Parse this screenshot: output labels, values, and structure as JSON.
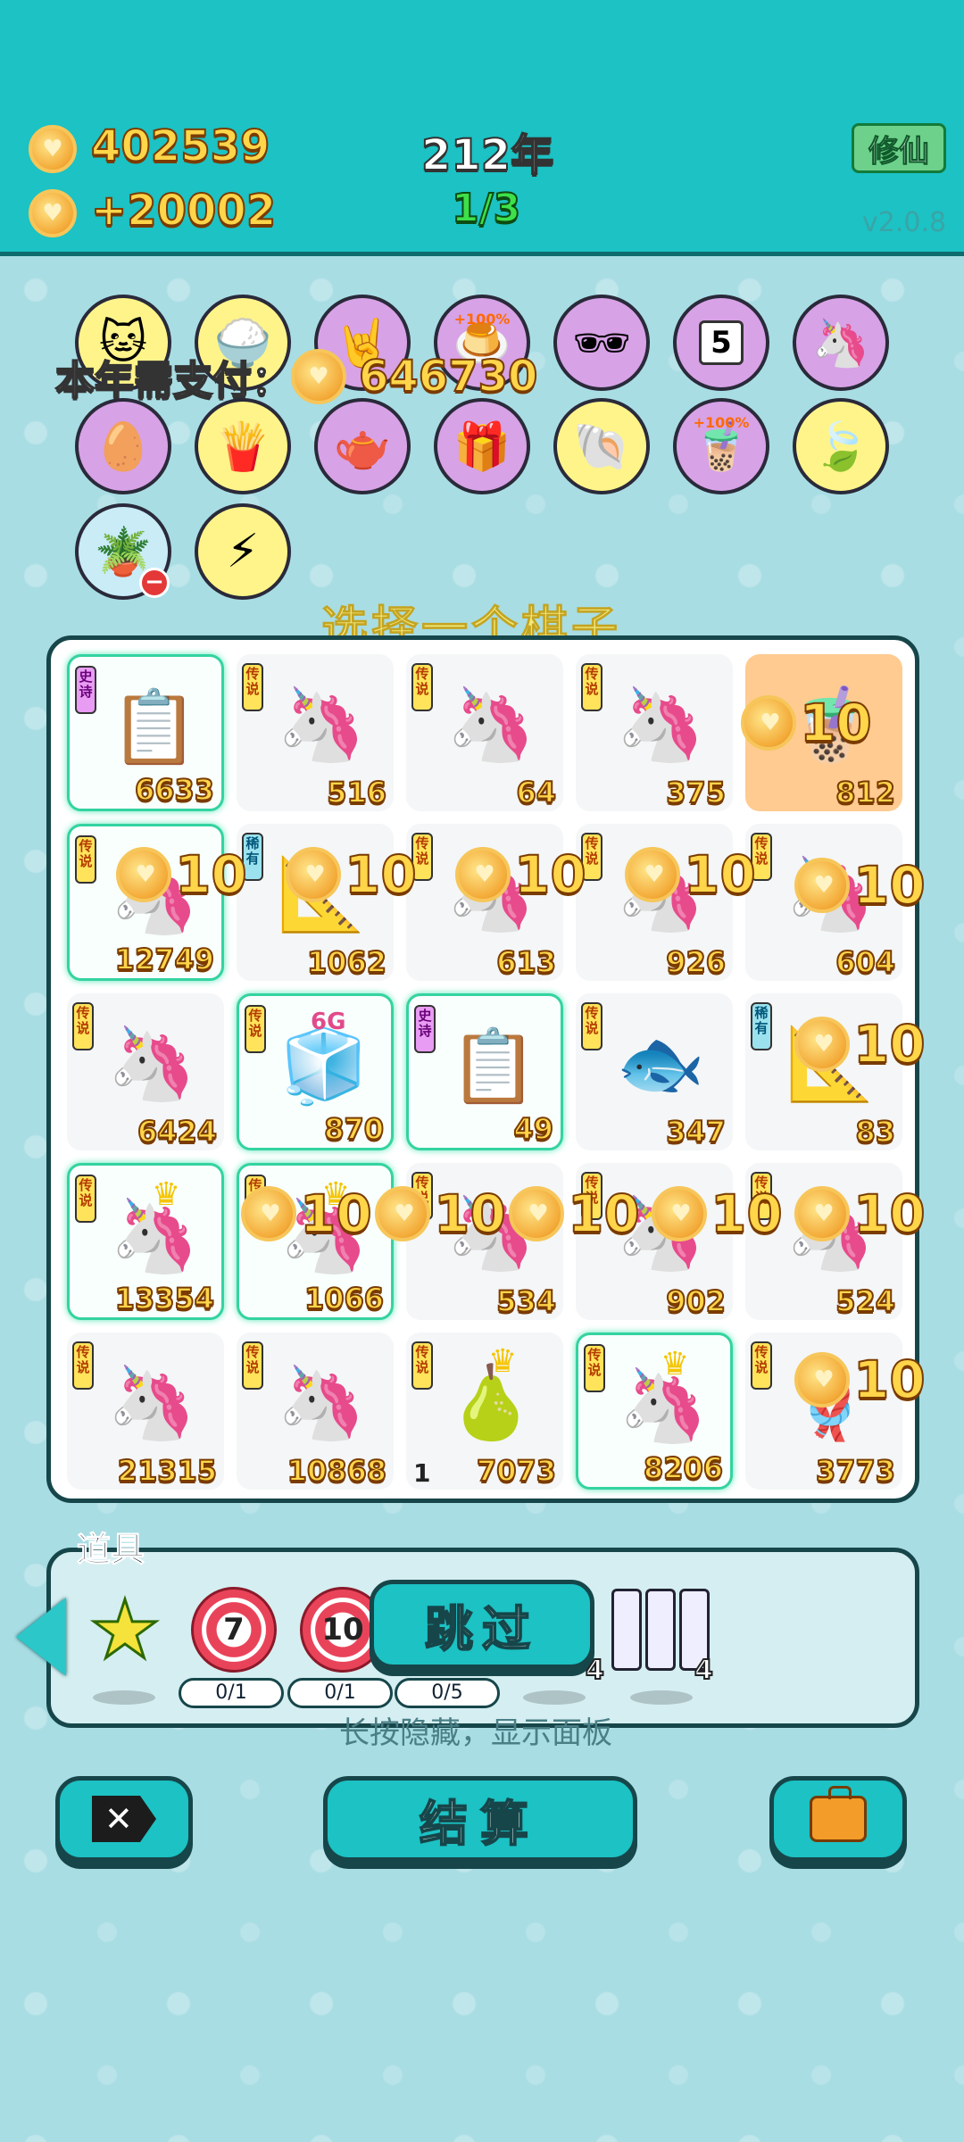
{
  "header": {
    "money": "402539",
    "income": "+20002",
    "year": "212年",
    "round": "1/3",
    "mode_button": "修仙",
    "version": "v2.0.8"
  },
  "symbols": {
    "pay_label": "本年需支付：",
    "pay_amount": "646730",
    "row1": [
      {
        "icon": "cat-face-icon",
        "color": "yellow",
        "tag": ""
      },
      {
        "icon": "rice-cooker-icon",
        "color": "yellow",
        "tag": ""
      },
      {
        "icon": "rock-hand-icon",
        "color": "purple",
        "tag": ""
      },
      {
        "icon": "pudding-icon",
        "color": "purple",
        "tag": "+100%"
      },
      {
        "icon": "sunglasses-icon",
        "color": "purple",
        "tag": ""
      },
      {
        "icon": "calendar-icon",
        "color": "purple",
        "tag": "5"
      },
      {
        "icon": "twin-unicorn-icon",
        "color": "purple",
        "tag": ""
      }
    ],
    "row2": [
      {
        "icon": "egg-icon",
        "color": "purple",
        "tag": ""
      },
      {
        "icon": "fries-icon",
        "color": "yellow",
        "tag": ""
      },
      {
        "icon": "gravy-boat-icon",
        "color": "purple",
        "tag": ""
      },
      {
        "icon": "gift-box-icon",
        "color": "purple",
        "tag": ""
      },
      {
        "icon": "shell-icon",
        "color": "yellow",
        "tag": ""
      },
      {
        "icon": "bubble-tea-icon",
        "color": "purple",
        "tag": "+100%"
      },
      {
        "icon": "leaf-icon",
        "color": "yellow",
        "tag": ""
      }
    ],
    "row3": [
      {
        "icon": "flower-pot-icon",
        "color": "blue",
        "tag": ""
      },
      {
        "icon": "lightning-icon",
        "color": "yellow",
        "tag": ""
      }
    ]
  },
  "board": {
    "prompt": "选择一个棋子",
    "cells": [
      {
        "badge": "史诗",
        "kind": "epic",
        "art": "copy-paste-icon",
        "value": "6633",
        "glow": true
      },
      {
        "badge": "传说",
        "kind": "leg",
        "art": "unicorn-icon",
        "value": "516",
        "glow": false
      },
      {
        "badge": "传说",
        "kind": "leg",
        "art": "unicorn-icon",
        "value": "64",
        "glow": false
      },
      {
        "badge": "传说",
        "kind": "leg",
        "art": "unicorn-icon",
        "value": "375",
        "glow": false
      },
      {
        "badge": "",
        "kind": "",
        "art": "bubble-tea-icon",
        "value": "812",
        "glow": false,
        "orange": true
      },
      {
        "badge": "传说",
        "kind": "leg",
        "art": "unicorn-icon",
        "value": "12749",
        "glow": true
      },
      {
        "badge": "稀有",
        "kind": "rare",
        "art": "ruler-icon",
        "value": "1062",
        "glow": false
      },
      {
        "badge": "传说",
        "kind": "leg",
        "art": "unicorn-icon",
        "value": "613",
        "glow": false
      },
      {
        "badge": "传说",
        "kind": "leg",
        "art": "unicorn-icon",
        "value": "926",
        "glow": false
      },
      {
        "badge": "传说",
        "kind": "leg",
        "art": "unicorn-icon",
        "value": "604",
        "glow": false
      },
      {
        "badge": "传说",
        "kind": "leg",
        "art": "unicorn-icon",
        "value": "6424",
        "glow": false
      },
      {
        "badge": "传说",
        "kind": "leg",
        "art": "fridge-icon",
        "value": "870",
        "glow": true
      },
      {
        "badge": "史诗",
        "kind": "epic",
        "art": "copy-paste-icon",
        "value": "49",
        "glow": true
      },
      {
        "badge": "传说",
        "kind": "leg",
        "art": "koi-fish-icon",
        "value": "347",
        "glow": false
      },
      {
        "badge": "稀有",
        "kind": "rare",
        "art": "ruler-icon",
        "value": "83",
        "glow": false
      },
      {
        "badge": "传说",
        "kind": "leg",
        "art": "crowned-unicorn-icon",
        "value": "13354",
        "glow": true
      },
      {
        "badge": "传说",
        "kind": "leg",
        "art": "crowned-unicorn-icon",
        "value": "1066",
        "glow": true
      },
      {
        "badge": "传说",
        "kind": "leg",
        "art": "unicorn-icon",
        "value": "534",
        "glow": false
      },
      {
        "badge": "传说",
        "kind": "leg",
        "art": "unicorn-icon",
        "value": "902",
        "glow": false
      },
      {
        "badge": "传说",
        "kind": "leg",
        "art": "unicorn-icon",
        "value": "524",
        "glow": false
      },
      {
        "badge": "传说",
        "kind": "leg",
        "art": "unicorn-icon",
        "value": "21315",
        "glow": false
      },
      {
        "badge": "传说",
        "kind": "leg",
        "art": "unicorn-icon",
        "value": "10868",
        "glow": false
      },
      {
        "badge": "传说",
        "kind": "leg",
        "art": "pear-icon",
        "value": "7073",
        "glow": false,
        "extra": "1"
      },
      {
        "badge": "传说",
        "kind": "leg",
        "art": "crowned-unicorn-icon",
        "value": "8206",
        "glow": true
      },
      {
        "badge": "传说",
        "kind": "leg",
        "art": "chinese-knot-icon",
        "value": "3773",
        "glow": false
      }
    ],
    "bonus_text": "10",
    "fridge_label": "6G"
  },
  "tools": {
    "title": "道具",
    "items": [
      {
        "icon": "star-icon",
        "label": ""
      },
      {
        "icon": "target-icon",
        "label": "7",
        "counter": "0/1"
      },
      {
        "icon": "target-icon",
        "label": "10",
        "counter": "0/1"
      },
      {
        "icon": "target-icon",
        "label": "",
        "counter": "0/5"
      }
    ],
    "count_a": "4",
    "count_b": "4",
    "skip_label": "跳过",
    "hint": "长按隐藏，显示面板"
  },
  "bottom": {
    "settle_label": "结算"
  },
  "colors": {
    "teal": "#1cc2c4",
    "gold": "#ffd54a",
    "green_round": "#3ee04a"
  }
}
